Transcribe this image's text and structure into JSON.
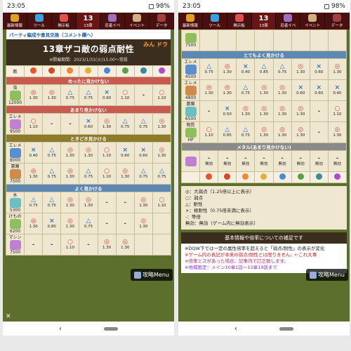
{
  "status": {
    "time": "23:05",
    "battery": "98%"
  },
  "nav": {
    "items": [
      "最新情報",
      "ツール",
      "掲示板",
      "13",
      "13章",
      "忍者イベ",
      "イベント",
      "データ"
    ]
  },
  "left": {
    "party_text": "パーティ編成や意見交換（コメント欄へ）",
    "title": "13章ザコ敵の弱点耐性",
    "period": "※開催期間：2023/1/31(火)15:00〜常設",
    "logo": "みん ドラ",
    "header_label": "敵",
    "sections": [
      {
        "label": "めったに見かけない",
        "cls": "",
        "rows": [
          {
            "name": "虫",
            "hp": "12000",
            "cells": [
              [
                "◎",
                "1.30"
              ],
              [
                "◎",
                "1.30"
              ],
              [
                "△",
                "0.75"
              ],
              [
                "△",
                "0.75"
              ],
              [
                "×",
                "0.60"
              ],
              [
                "○",
                "1.10"
              ],
              [
                "-",
                ""
              ],
              [
                "○",
                "1.10"
              ]
            ]
          }
        ]
      },
      {
        "label": "あまり見かけない",
        "cls": "",
        "rows": [
          {
            "name": "エレメ",
            "hp": "9500",
            "cells": [
              [
                "○",
                "1.10"
              ],
              [
                "-",
                ""
              ],
              [
                "-",
                ""
              ],
              [
                "×",
                "0.60"
              ],
              [
                "◎",
                "1.30"
              ],
              [
                "△",
                "0.75"
              ],
              [
                "△",
                "0.75"
              ],
              [
                "◎",
                "1.30"
              ]
            ]
          }
        ]
      },
      {
        "label": "ときどき見かける",
        "cls": "olive",
        "rows": [
          {
            "name": "エレメ",
            "hp": "8000",
            "cells": [
              [
                "×",
                "0.40"
              ],
              [
                "△",
                "0.75"
              ],
              [
                "◎",
                "1.30"
              ],
              [
                "◎",
                "1.30"
              ],
              [
                "○",
                "1.10"
              ],
              [
                "×",
                "0.60"
              ],
              [
                "×",
                "0.60"
              ],
              [
                "◎",
                "1.30"
              ]
            ]
          },
          {
            "name": "悪魔",
            "hp": "7500",
            "cells": [
              [
                "◎",
                "1.30"
              ],
              [
                "△",
                "0.75"
              ],
              [
                "◎",
                "1.30"
              ],
              [
                "△",
                "0.75"
              ],
              [
                "○",
                "1.10"
              ],
              [
                "◎",
                "1.30"
              ],
              [
                "△",
                "0.75"
              ],
              [
                "△",
                "0.75"
              ]
            ]
          }
        ]
      },
      {
        "label": "よく見かける",
        "cls": "blue",
        "rows": [
          {
            "name": "水",
            "hp": "5300",
            "cells": [
              [
                "△",
                "0.75"
              ],
              [
                "△",
                "0.75"
              ],
              [
                "◎",
                "1.30"
              ],
              [
                "◎",
                "1.30"
              ],
              [
                "-",
                ""
              ],
              [
                "-",
                ""
              ],
              [
                "◎",
                "1.30"
              ],
              [
                "○",
                "1.10"
              ]
            ]
          },
          {
            "name": "けもの",
            "hp": "6200",
            "cells": [
              [
                "◎",
                "1.30"
              ],
              [
                "×",
                "0.80"
              ],
              [
                "◎",
                "1.30"
              ],
              [
                "△",
                "0.75"
              ],
              [
                "-",
                ""
              ],
              [
                "-",
                ""
              ],
              [
                "◎",
                "1.30"
              ],
              [
                "",
                ""
              ]
            ]
          },
          {
            "name": "マシン",
            "hp": "7500",
            "cells": [
              [
                "-",
                ""
              ],
              [
                "-",
                ""
              ],
              [
                "○",
                "1.10"
              ],
              [
                "-",
                ""
              ],
              [
                "◎",
                "1.30"
              ],
              [
                "◎",
                "1.30"
              ],
              [
                "",
                ""
              ],
              [
                "",
                ""
              ]
            ]
          }
        ]
      }
    ]
  },
  "right": {
    "top_row": {
      "name": "",
      "hp": "7500",
      "cells": [
        [
          "",
          ""
        ],
        [
          "",
          ""
        ],
        [
          "",
          ""
        ],
        [
          "",
          ""
        ],
        [
          "",
          ""
        ],
        [
          "",
          ""
        ],
        [
          "",
          ""
        ],
        [
          "",
          ""
        ]
      ]
    },
    "sections": [
      {
        "label": "とてもよく見かける",
        "cls": "blue",
        "rows": [
          {
            "name": "エレメ",
            "hp": "4500",
            "cells": [
              [
                "△",
                "0.75"
              ],
              [
                "◎",
                "1.30"
              ],
              [
                "×",
                "0.40"
              ],
              [
                "△",
                "0.85"
              ],
              [
                "△",
                "0.75"
              ],
              [
                "◎",
                "1.30"
              ],
              [
                "×",
                "0.60"
              ],
              [
                "◎",
                "1.30"
              ]
            ]
          },
          {
            "name": "エレメ",
            "hp": "4800",
            "cells": [
              [
                "◎",
                "1.30"
              ],
              [
                "◎",
                "1.30"
              ],
              [
                "△",
                "0.75"
              ],
              [
                "◎",
                "1.30"
              ],
              [
                "◎",
                "1.30"
              ],
              [
                "×",
                "0.60"
              ],
              [
                "×",
                "0.60"
              ],
              [
                "×",
                "0.40"
              ]
            ]
          },
          {
            "name": "悪魔",
            "hp": "6500",
            "cells": [
              [
                "-",
                ""
              ],
              [
                "×",
                "0.50"
              ],
              [
                "◎",
                "1.30"
              ],
              [
                "◎",
                "1.30"
              ],
              [
                "◎",
                "1.30"
              ],
              [
                "◎",
                "1.30"
              ],
              [
                "-",
                ""
              ],
              [
                "○",
                "1.10"
              ]
            ]
          },
          {
            "name": "物質",
            "hp": "HP",
            "cells": [
              [
                "○",
                "1.10"
              ],
              [
                "△",
                "0.85"
              ],
              [
                "△",
                "0.75"
              ],
              [
                "◎",
                "1.30"
              ],
              [
                "◎",
                "1.30"
              ],
              [
                "◎",
                "1.30"
              ],
              [
                "-",
                ""
              ],
              [
                "◎",
                "1.30"
              ]
            ]
          }
        ]
      },
      {
        "label": "メタル(あまり見かけない)",
        "cls": "gray",
        "rows": [
          {
            "name": "",
            "hp": "",
            "cells": [
              [
                "-",
                "無効"
              ],
              [
                "-",
                "無効"
              ],
              [
                "-",
                "無効"
              ],
              [
                "-",
                "無効"
              ],
              [
                "-",
                "無効"
              ],
              [
                "-",
                "無効"
              ],
              [
                "-",
                "無効"
              ],
              [
                "-",
                "無効"
              ]
            ]
          }
        ]
      }
    ],
    "legend": [
      "◎：大弱点（1.25倍以上に表示）",
      "○：弱点",
      "△：耐性",
      "×：極耐性（0.75倍未満に表示）",
      "-：等倍",
      "無効：無効（ゲーム内に無効表示）"
    ],
    "info_head": "基本情報や倍率についての補足です",
    "notes": [
      {
        "t": "※DQW下では一定の属性倍率を超えると「弱点/耐性」の表示が変化",
        "c": ""
      },
      {
        "t": "※ゲーム内の表記が本来の弱点/耐性とは限りません。←これ大事",
        "c": "red"
      },
      {
        "t": "※倍率ミスがあった場合、記事内で訂正致します。",
        "c": "pink"
      },
      {
        "t": "※地域限定：メイン10章1話〜13章10話まで",
        "c": "purple"
      }
    ]
  },
  "menu_label": "攻略Menu",
  "elements": [
    "#e8552a",
    "#d84a1e",
    "#f08a2a",
    "#e6b030",
    "#4a8ad8",
    "#5aa040",
    "#3a8a9a",
    "#b04ac8",
    "#8a6a40"
  ]
}
